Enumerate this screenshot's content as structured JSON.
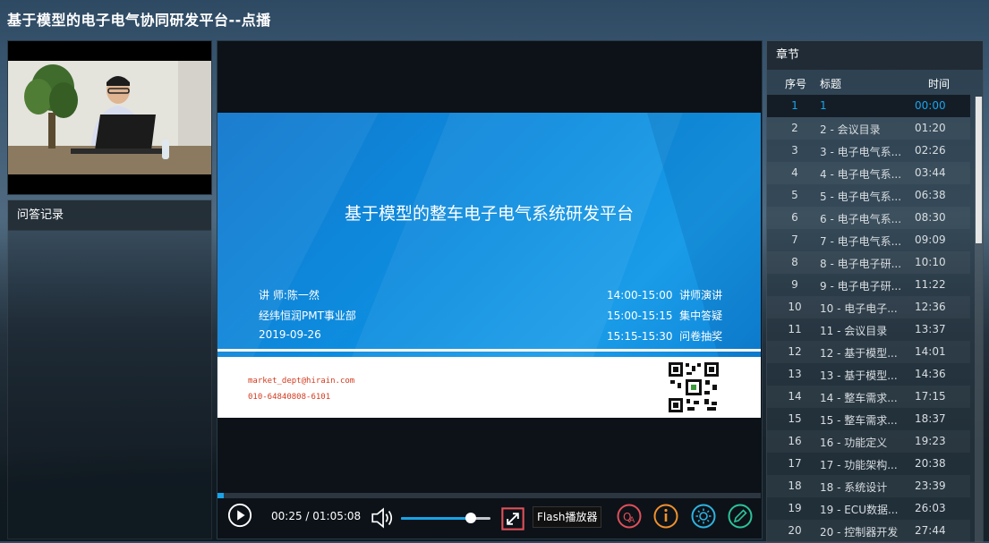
{
  "page": {
    "title": "基于模型的电子电气协同研发平台--点播"
  },
  "qa": {
    "title": "问答记录"
  },
  "slide": {
    "title": "基于模型的整车电子电气系统研发平台",
    "speaker": "讲  师:陈一然",
    "org": "经纬恒润PMT事业部",
    "date": "2019-09-26",
    "schedule": [
      {
        "time": "14:00-15:00",
        "label": "讲师演讲"
      },
      {
        "time": "15:00-15:15",
        "label": "集中答疑"
      },
      {
        "time": "15:15-15:30",
        "label": "问卷抽奖"
      }
    ],
    "email": "market_dept@hirain.com",
    "phone": "010-64840808-6101"
  },
  "player": {
    "current": "00:25",
    "duration": "01:05:08",
    "time_display": "00:25 / 01:05:08",
    "progress": 0.011,
    "volume": 0.78,
    "flash_label": "Flash播放器",
    "accent": "#1aa3e6"
  },
  "chapters": {
    "title": "章节",
    "columns": {
      "no": "序号",
      "title": "标题",
      "time": "时间"
    },
    "items": [
      {
        "no": "1",
        "title": "1",
        "time": "00:00"
      },
      {
        "no": "2",
        "title": "2 - 会议目录",
        "time": "01:20"
      },
      {
        "no": "3",
        "title": "3 - 电子电气系...",
        "time": "02:26"
      },
      {
        "no": "4",
        "title": "4 - 电子电气系...",
        "time": "03:44"
      },
      {
        "no": "5",
        "title": "5 - 电子电气系...",
        "time": "06:38"
      },
      {
        "no": "6",
        "title": "6 - 电子电气系...",
        "time": "08:30"
      },
      {
        "no": "7",
        "title": "7 - 电子电气系...",
        "time": "09:09"
      },
      {
        "no": "8",
        "title": "8 - 电子电子研...",
        "time": "10:10"
      },
      {
        "no": "9",
        "title": "9 - 电子电子研...",
        "time": "11:22"
      },
      {
        "no": "10",
        "title": "10 - 电子电子...",
        "time": "12:36"
      },
      {
        "no": "11",
        "title": "11 - 会议目录",
        "time": "13:37"
      },
      {
        "no": "12",
        "title": "12 - 基于模型...",
        "time": "14:01"
      },
      {
        "no": "13",
        "title": "13 - 基于模型...",
        "time": "14:36"
      },
      {
        "no": "14",
        "title": "14 - 整车需求...",
        "time": "17:15"
      },
      {
        "no": "15",
        "title": "15 - 整车需求...",
        "time": "18:37"
      },
      {
        "no": "16",
        "title": "16 - 功能定义",
        "time": "19:23"
      },
      {
        "no": "17",
        "title": "17 - 功能架构...",
        "time": "20:38"
      },
      {
        "no": "18",
        "title": "18 - 系统设计",
        "time": "23:39"
      },
      {
        "no": "19",
        "title": "19 - ECU数据...",
        "time": "26:03"
      },
      {
        "no": "20",
        "title": "20 - 控制器开发",
        "time": "27:44"
      }
    ],
    "selected_index": 0,
    "selected_color": "#1aa3ef"
  },
  "icons": {
    "play": "play-icon",
    "volume": "volume-icon",
    "fullscreen": "fullscreen-icon",
    "qa": "qa-icon",
    "info": "info-icon",
    "brightness": "brightness-icon",
    "edit": "pencil-icon"
  }
}
